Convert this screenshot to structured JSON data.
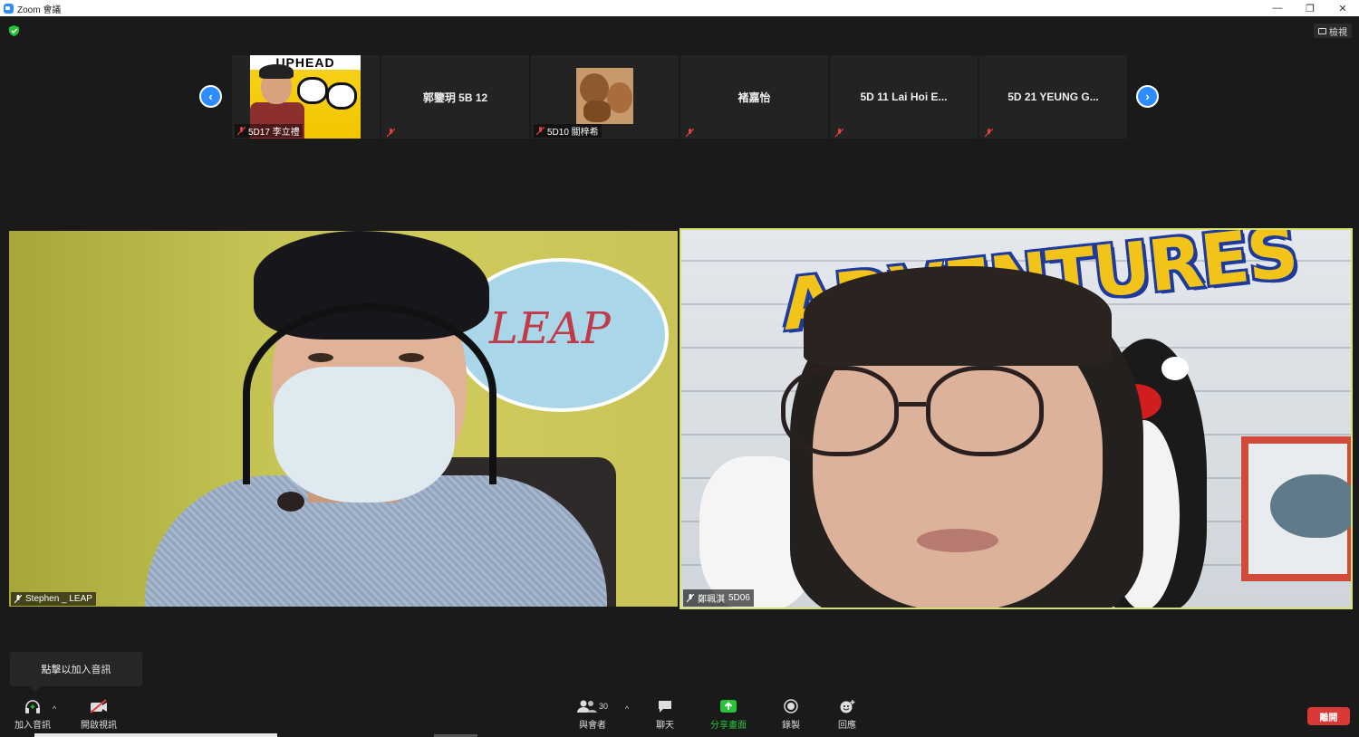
{
  "window": {
    "title": "Zoom 會議",
    "controls": [
      "—",
      "❐",
      "✕"
    ]
  },
  "top": {
    "view_label": "檢視"
  },
  "filmstrip": {
    "prev_arrow": "‹",
    "next_arrow": "›",
    "tiles": [
      {
        "label": "5D17 李立禮",
        "thumb_text": "UPHEAD"
      },
      {
        "name": "郭鑒玥 5B 12"
      },
      {
        "label": "5D10 關梓希"
      },
      {
        "name": "褚嘉怡"
      },
      {
        "name": "5D 11 Lai Hoi E..."
      },
      {
        "name": "5D 21 YEUNG G..."
      }
    ]
  },
  "videos": {
    "left": {
      "name": "Stephen _ LEAP",
      "logo": "LEAP"
    },
    "right": {
      "name": "鄭珮淇 ",
      "class": "5D06",
      "banner": "ADVENTURES"
    }
  },
  "tooltip": {
    "text": "點擊以加入音訊"
  },
  "toolbar": {
    "join_audio": "加入音訊",
    "start_video": "開啟視訊",
    "participants": "與會者",
    "participant_count": "30",
    "chat": "聊天",
    "share_screen": "分享畫面",
    "record": "錄製",
    "reactions": "回應",
    "leave": "離開",
    "caret": "^"
  },
  "colors": {
    "accent": "#2d8cff",
    "share_green": "#27c43a",
    "leave_red": "#d93834",
    "active_speaker_border": "#d8e26a"
  }
}
